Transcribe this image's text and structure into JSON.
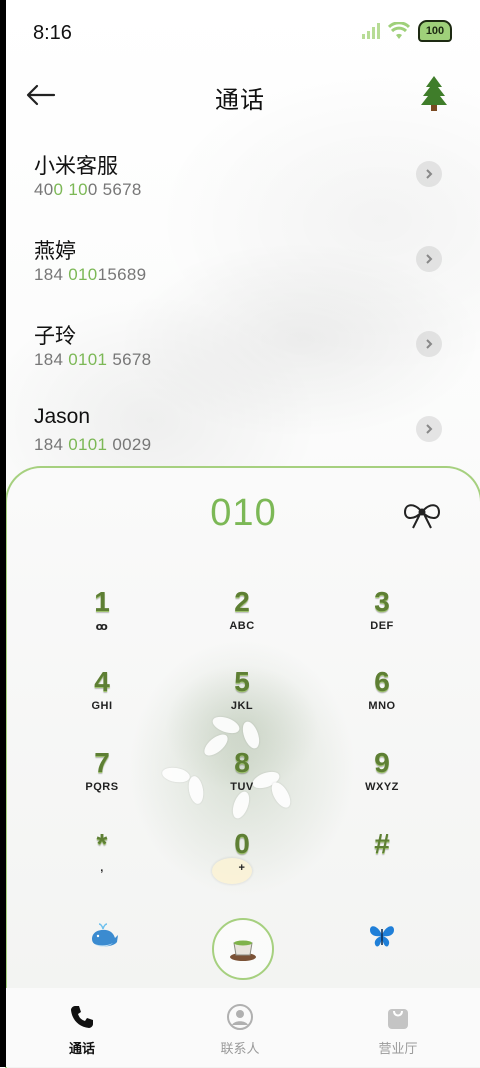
{
  "status_bar": {
    "time": "8:16",
    "battery_text": "100"
  },
  "header": {
    "title": "通话"
  },
  "contacts": [
    {
      "name": "小米客服",
      "num_pre": "40",
      "num_hl1": "0",
      "num_mid": " ",
      "num_hl2": "10",
      "num_post": "0 5678"
    },
    {
      "name": "燕婷",
      "num_pre": "184 ",
      "num_hl1": "010",
      "num_mid": "",
      "num_hl2": "",
      "num_post": "15689"
    },
    {
      "name": "子玲",
      "num_pre": "184 ",
      "num_hl1": "0101",
      "num_mid": "",
      "num_hl2": "",
      "num_post": " 5678"
    },
    {
      "name": "Jason",
      "num_pre": "184 ",
      "num_hl1": "0101",
      "num_mid": "",
      "num_hl2": "",
      "num_post": " 0029"
    }
  ],
  "dialer": {
    "display": "010",
    "keys": [
      {
        "digit": "1",
        "letters": "ꝏ"
      },
      {
        "digit": "2",
        "letters": "ABC"
      },
      {
        "digit": "3",
        "letters": "DEF"
      },
      {
        "digit": "4",
        "letters": "GHI"
      },
      {
        "digit": "5",
        "letters": "JKL"
      },
      {
        "digit": "6",
        "letters": "MNO"
      },
      {
        "digit": "7",
        "letters": "PQRS"
      },
      {
        "digit": "8",
        "letters": "TUV"
      },
      {
        "digit": "9",
        "letters": "WXYZ"
      },
      {
        "digit": "*",
        "letters": ","
      },
      {
        "digit": "0",
        "letters": "+"
      },
      {
        "digit": "#",
        "letters": ""
      }
    ]
  },
  "bottom_nav": [
    {
      "label": "通话",
      "icon": "phone-icon"
    },
    {
      "label": "联系人",
      "icon": "contact-icon"
    },
    {
      "label": "营业厅",
      "icon": "store-bag-icon"
    }
  ],
  "colors": {
    "accent_green": "#7cb856",
    "digit_green": "#5e7f34",
    "border_green": "#a6d07f"
  }
}
